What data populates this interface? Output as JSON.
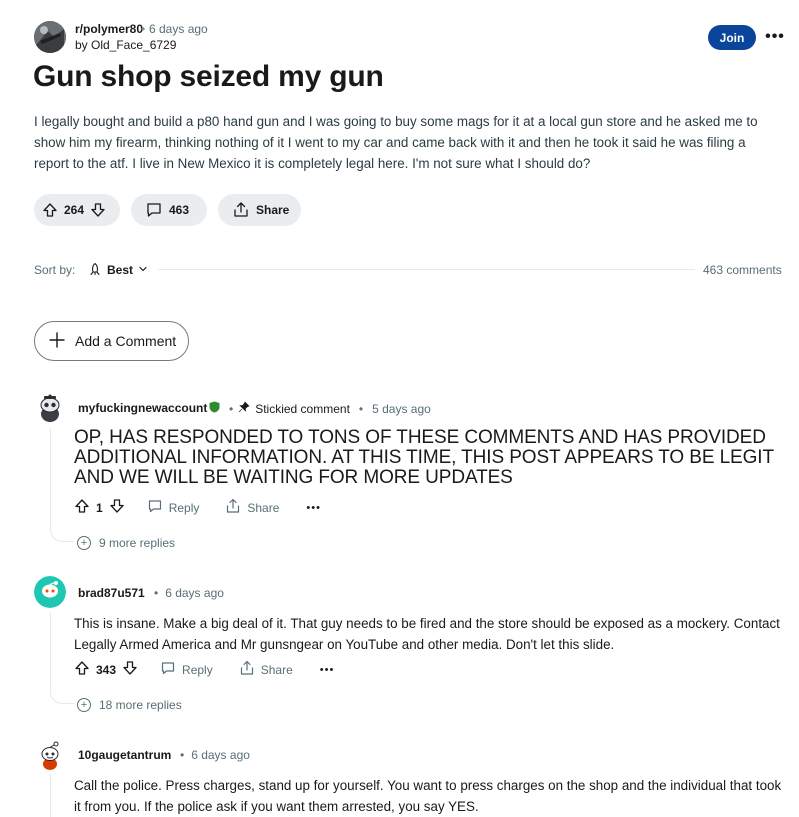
{
  "post": {
    "subreddit": "r/polymer80",
    "time": "6 days ago",
    "author": "by Old_Face_6729",
    "join_label": "Join",
    "more_label": "•••",
    "title": "Gun shop seized my gun",
    "body": "I legally bought and build a p80 hand gun and I was going to buy some mags for it at a local gun store and he asked me to show him my firearm, thinking nothing of it I went to my car and came back with it and then he took it said he was filing a report to the atf. I live in New Mexico it is completely legal here. I'm not sure what I should do?",
    "votes": "264",
    "comments": "463",
    "share_label": "Share"
  },
  "sort": {
    "label": "Sort by:",
    "value": "Best",
    "count": "463 comments"
  },
  "add_comment_label": "Add a Comment",
  "comments": [
    {
      "author": "myfuckingnewaccount",
      "stickied": "Stickied comment",
      "time": "5 days ago",
      "text": "OP, HAS RESPONDED TO TONS OF THESE COMMENTS AND HAS PROVIDED ADDITIONAL INFORMATION. AT THIS TIME, THIS POST APPEARS TO BE LEGIT AND WE WILL BE WAITING FOR MORE UPDATES",
      "votes": "1",
      "reply_label": "Reply",
      "share_label": "Share",
      "more_label": "•••",
      "more_replies": "9 more replies"
    },
    {
      "author": "brad87u571",
      "time": "6 days ago",
      "text": "This is insane. Make a big deal of it. That guy needs to be fired and the store should be exposed as a mockery. Contact Legally Armed America and Mr gunsngear on YouTube and other media. Don't let this slide.",
      "votes": "343",
      "reply_label": "Reply",
      "share_label": "Share",
      "more_label": "•••",
      "more_replies": "18 more replies"
    },
    {
      "author": "10gaugetantrum",
      "time": "6 days ago",
      "text": "Call the police. Press charges, stand up for yourself. You want to press charges on the shop and the individual that took it from you. If the police ask if you want them arrested, you say YES."
    }
  ],
  "colors": {
    "join": "#0a449b",
    "pill": "#eaedef",
    "mod_green": "#2e8b2e",
    "avatar_teal": "#1fc7b3"
  }
}
